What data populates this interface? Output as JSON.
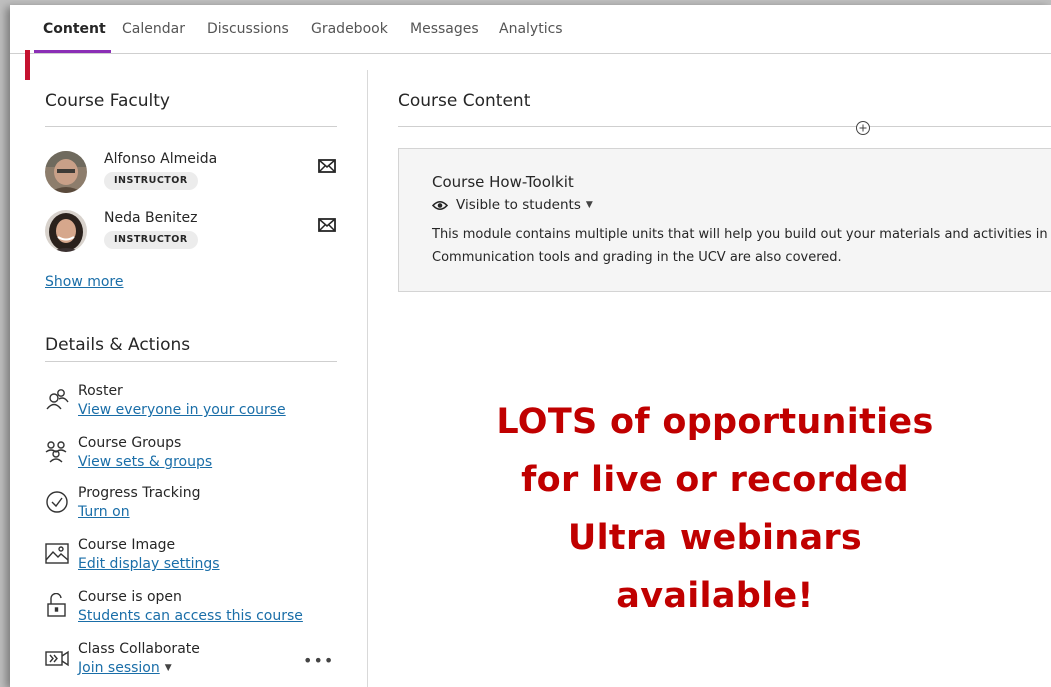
{
  "tabs": [
    {
      "label": "Content",
      "active": true
    },
    {
      "label": "Calendar",
      "active": false
    },
    {
      "label": "Discussions",
      "active": false
    },
    {
      "label": "Gradebook",
      "active": false
    },
    {
      "label": "Messages",
      "active": false
    },
    {
      "label": "Analytics",
      "active": false
    }
  ],
  "faculty": {
    "title": "Course Faculty",
    "members": [
      {
        "name": "Alfonso Almeida",
        "role": "INSTRUCTOR"
      },
      {
        "name": "Neda Benitez",
        "role": "INSTRUCTOR"
      }
    ],
    "show_more": "Show more"
  },
  "details": {
    "title": "Details & Actions",
    "actions": [
      {
        "title": "Roster",
        "link": "View everyone in your course",
        "icon": "roster-icon"
      },
      {
        "title": "Course Groups",
        "link": "View sets & groups",
        "icon": "groups-icon"
      },
      {
        "title": "Progress Tracking",
        "link": "Turn on",
        "icon": "check-circle-icon"
      },
      {
        "title": "Course Image",
        "link": "Edit display settings",
        "icon": "image-icon"
      },
      {
        "title": "Course is open",
        "link": "Students can access this course",
        "icon": "unlock-icon"
      },
      {
        "title": "Class Collaborate",
        "link": "Join session",
        "icon": "collaborate-icon"
      }
    ]
  },
  "content": {
    "title": "Course Content",
    "module": {
      "title": "Course How-Toolkit",
      "visibility": "Visible to students",
      "description_line1": "This module contains multiple units that will help you build out your materials and activities in",
      "description_line2": "Communication tools and grading in the UCV are also covered."
    }
  },
  "promo": {
    "line1": "LOTS of opportunities",
    "line2": "for live or recorded",
    "line3": "Ultra webinars",
    "line4": "available!"
  },
  "colors": {
    "tab_accent": "#8b2fb6",
    "marker": "#c4122f",
    "link": "#1a6ea8",
    "promo": "#c00000"
  }
}
